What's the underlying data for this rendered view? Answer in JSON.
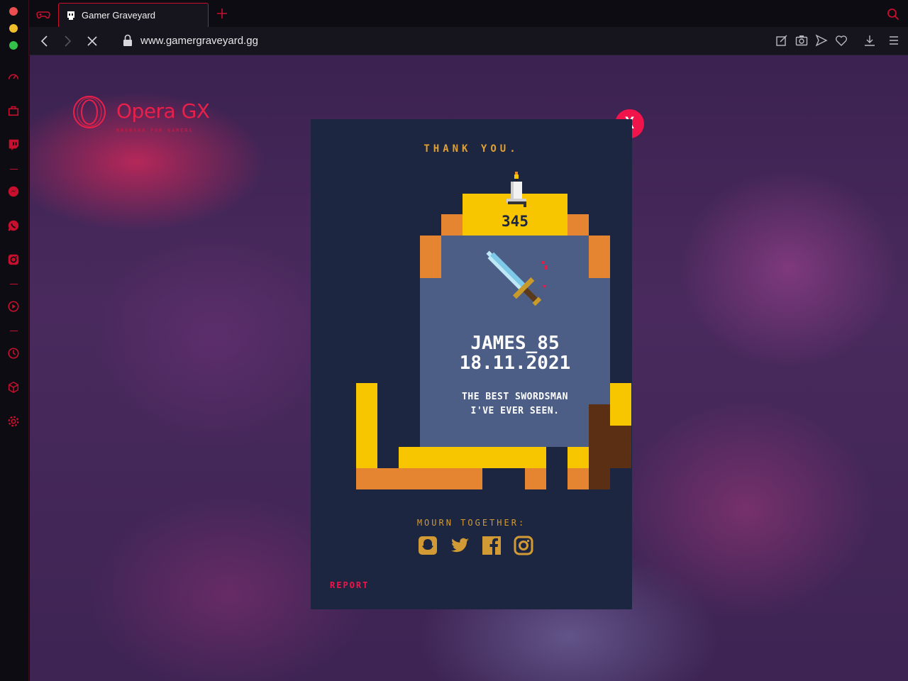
{
  "browser": {
    "tab": {
      "title": "Gamer Graveyard"
    },
    "address": {
      "url": "www.gamergraveyard.gg"
    }
  },
  "brand": {
    "name": "Opera GX",
    "tagline": "BROWSER FOR GAMERS"
  },
  "modal": {
    "close_label": "X",
    "heading": "THANK YOU.",
    "candle_count": "345",
    "player_name": "JAMES_85",
    "date": "18.11.2021",
    "epitaph_line1": "THE BEST SWORDSMAN",
    "epitaph_line2": "I'VE EVER SEEN.",
    "share_label": "MOURN TOGETHER:",
    "report_label": "REPORT",
    "social_icons": [
      "snapchat-icon",
      "twitter-icon",
      "facebook-icon",
      "instagram-icon"
    ]
  },
  "colors": {
    "accent": "#f0144a",
    "modal_bg": "#1c2640",
    "stone": "#4c5e86",
    "gold": "#f7c600",
    "orange": "#e58532",
    "dirt": "#5a2f14"
  }
}
